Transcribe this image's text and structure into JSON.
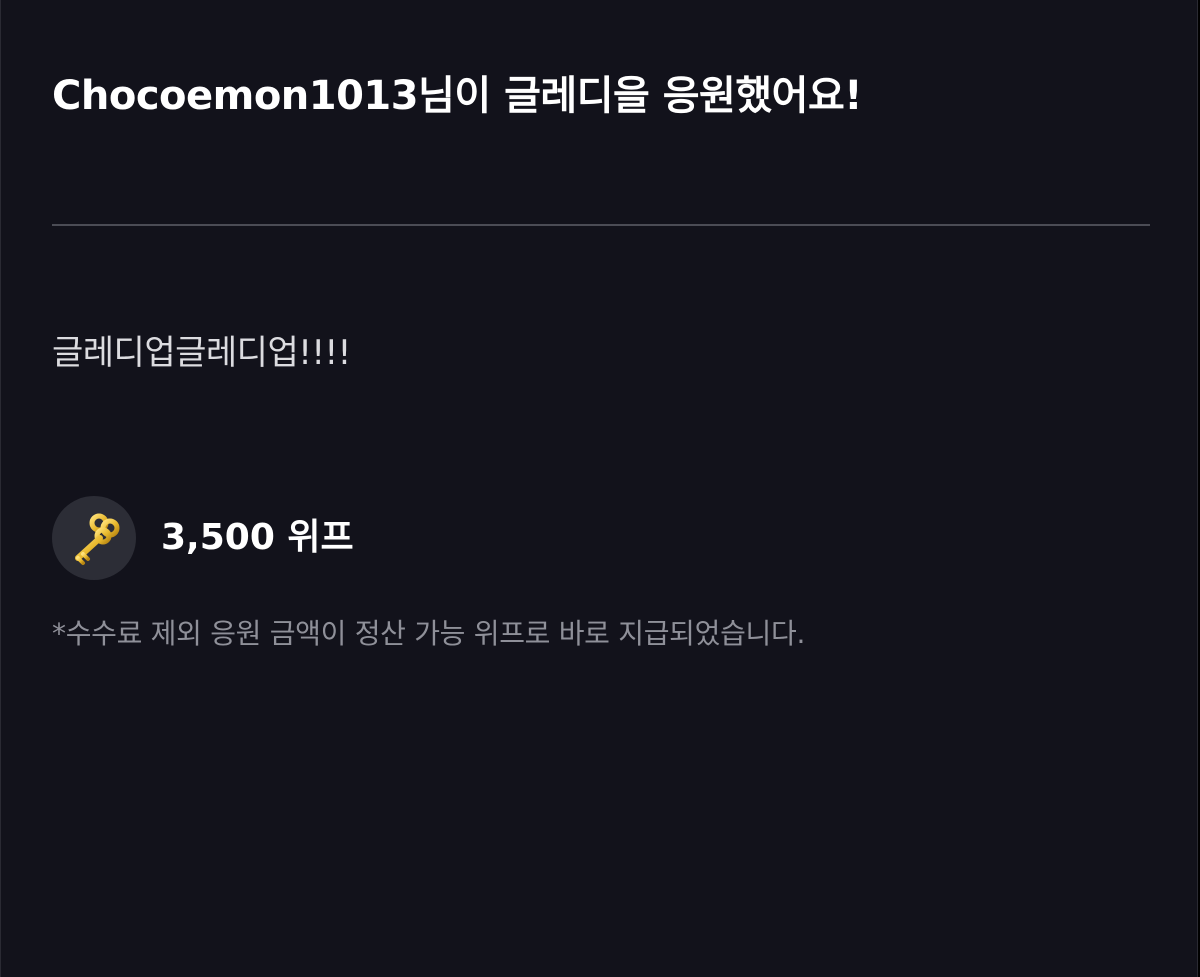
{
  "header": {
    "title": "Chocoemon1013님이 글레디을 응원했어요!"
  },
  "message": {
    "text": "글레디업글레디업!!!!"
  },
  "donation": {
    "icon": "key-icon",
    "amount": "3,500 위프",
    "icon_color": "#e8b92e"
  },
  "footnote": {
    "text": "*수수료 제외 응원 금액이 정산 가능 위프로 바로 지급되었습니다."
  }
}
